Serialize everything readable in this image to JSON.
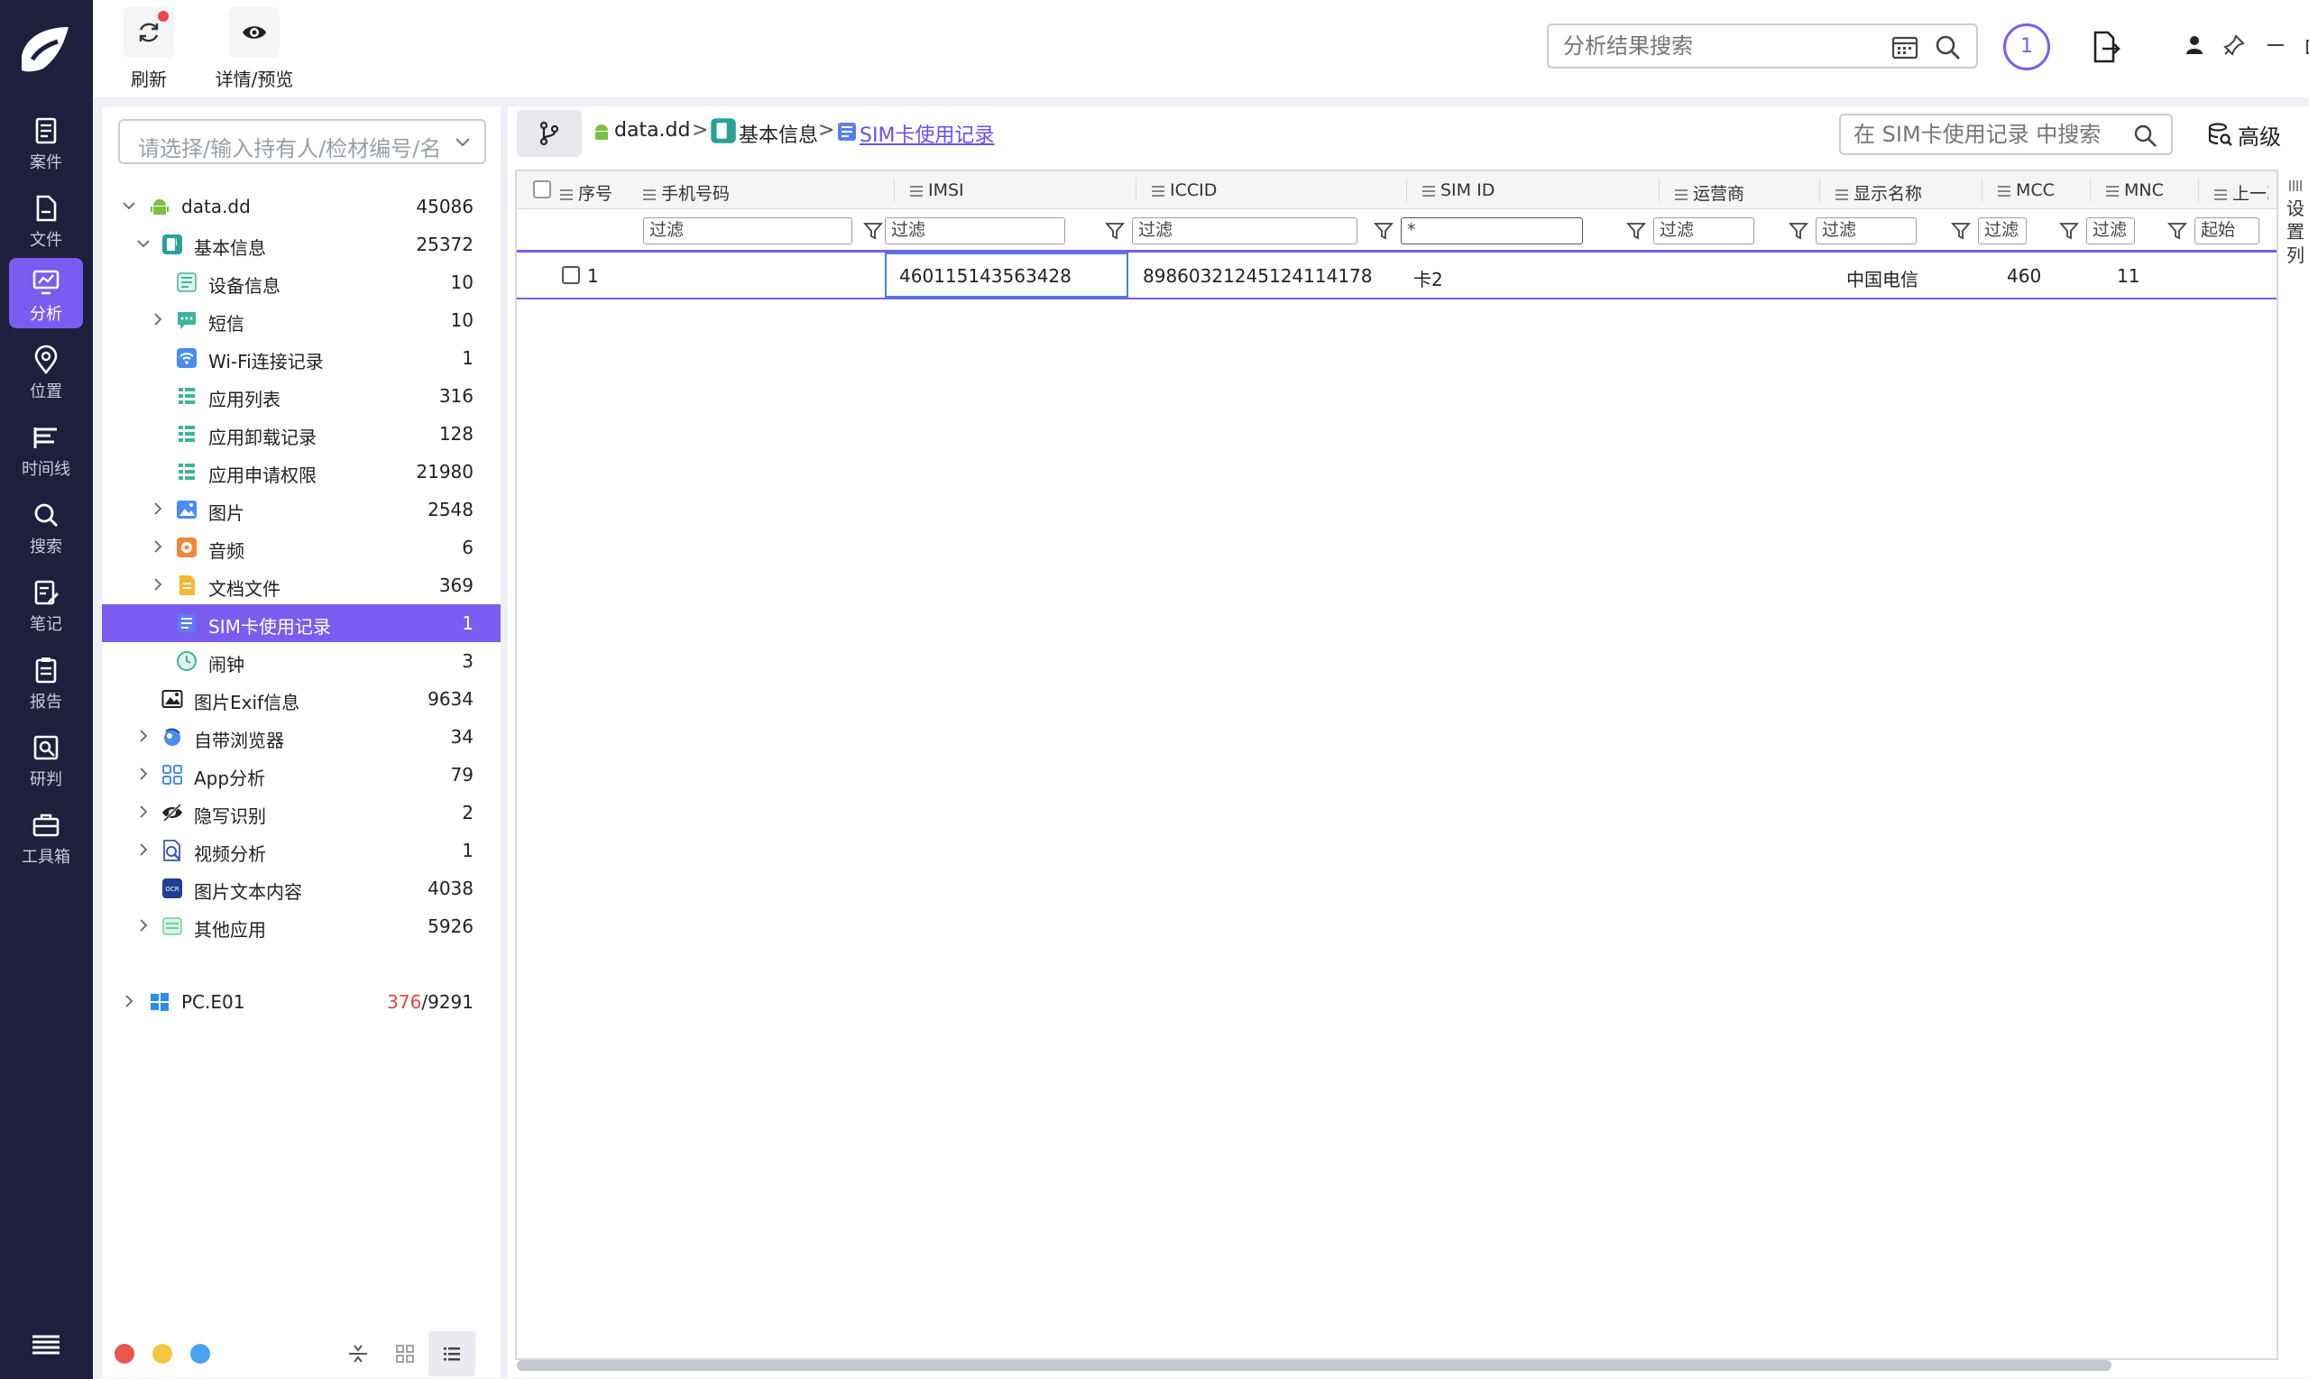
{
  "rail": {
    "items": [
      {
        "label": "案件",
        "icon": "case-icon"
      },
      {
        "label": "文件",
        "icon": "file-icon"
      },
      {
        "label": "分析",
        "icon": "analysis-icon",
        "active": true
      },
      {
        "label": "位置",
        "icon": "location-icon"
      },
      {
        "label": "时间线",
        "icon": "timeline-icon"
      },
      {
        "label": "搜索",
        "icon": "search-icon"
      },
      {
        "label": "笔记",
        "icon": "note-icon"
      },
      {
        "label": "报告",
        "icon": "report-icon"
      },
      {
        "label": "研判",
        "icon": "judge-icon"
      },
      {
        "label": "工具箱",
        "icon": "toolbox-icon"
      }
    ]
  },
  "toolbar": {
    "refresh_label": "刷新",
    "preview_label": "详情/预览",
    "search_placeholder": "分析结果搜索",
    "badge_count": "1"
  },
  "tree": {
    "select_placeholder": "请选择/输入持有人/检材编号/名",
    "nodes": [
      {
        "label": "data.dd",
        "count": "45086"
      },
      {
        "label": "基本信息",
        "count": "25372"
      },
      {
        "label": "设备信息",
        "count": "10"
      },
      {
        "label": "短信",
        "count": "10"
      },
      {
        "label": "Wi-Fi连接记录",
        "count": "1"
      },
      {
        "label": "应用列表",
        "count": "316"
      },
      {
        "label": "应用卸载记录",
        "count": "128"
      },
      {
        "label": "应用申请权限",
        "count": "21980"
      },
      {
        "label": "图片",
        "count": "2548"
      },
      {
        "label": "音频",
        "count": "6"
      },
      {
        "label": "文档文件",
        "count": "369"
      },
      {
        "label": "SIM卡使用记录",
        "count": "1"
      },
      {
        "label": "闹钟",
        "count": "3"
      },
      {
        "label": "图片Exif信息",
        "count": "9634"
      },
      {
        "label": "自带浏览器",
        "count": "34"
      },
      {
        "label": "App分析",
        "count": "79"
      },
      {
        "label": "隐写识别",
        "count": "2"
      },
      {
        "label": "视频分析",
        "count": "1"
      },
      {
        "label": "图片文本内容",
        "count": "4038"
      },
      {
        "label": "其他应用",
        "count": "5926"
      },
      {
        "label": "PC.E01",
        "count_red": "376",
        "count_rest": "/9291"
      }
    ],
    "ocr_badge": "OCR"
  },
  "breadcrumb": {
    "items": [
      "data.dd",
      "基本信息",
      "SIM卡使用记录"
    ],
    "sep": ">"
  },
  "subsearch": {
    "placeholder": "在 SIM卡使用记录 中搜索"
  },
  "advanced_label": "高级",
  "grid": {
    "columns": [
      "序号",
      "手机号码",
      "IMSI",
      "ICCID",
      "SIM ID",
      "运营商",
      "显示名称",
      "MCC",
      "MNC",
      "上一次"
    ],
    "filters": [
      "过滤",
      "过滤",
      "过滤",
      "*",
      "过滤",
      "过滤",
      "过滤",
      "过滤",
      "起始"
    ],
    "rows": [
      {
        "index": "1",
        "phone": "",
        "imsi": "460115143563428",
        "iccid": "89860321245124114178",
        "simid": "卡2",
        "carrier": "",
        "display": "中国电信",
        "mcc": "460",
        "mnc": "11"
      }
    ]
  },
  "side_column_label": [
    "设",
    "置",
    "列"
  ],
  "colors": {
    "rail": "#1d1f3d",
    "accent": "#7b5cf0",
    "link": "#6a4ff0",
    "red": "#e0453f"
  }
}
